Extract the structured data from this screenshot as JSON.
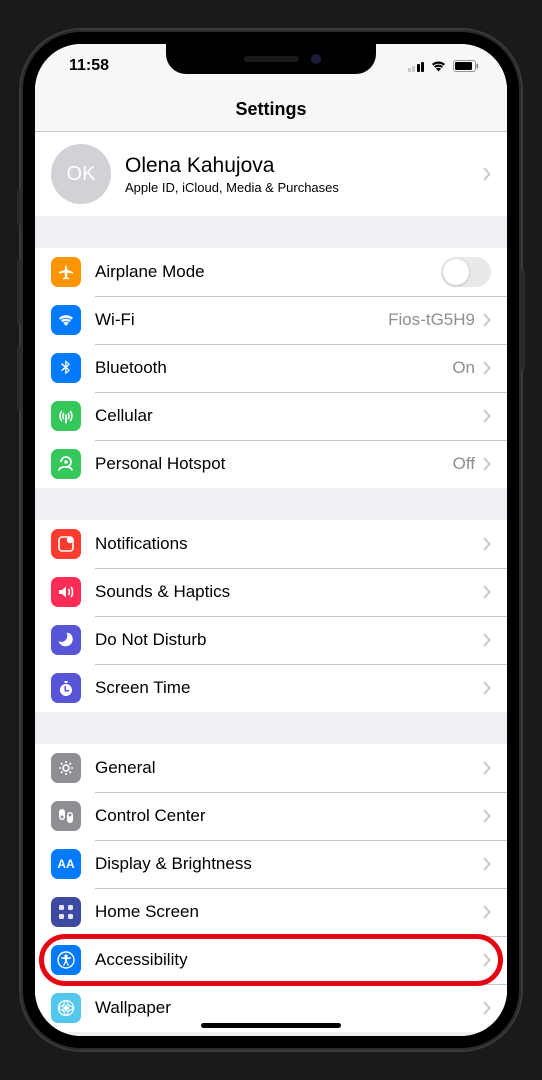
{
  "status": {
    "time": "11:58"
  },
  "title": "Settings",
  "profile": {
    "initials": "OK",
    "name": "Olena Kahujova",
    "subtitle": "Apple ID, iCloud, Media & Purchases"
  },
  "groups": [
    {
      "rows": [
        {
          "id": "airplane-mode",
          "label": "Airplane Mode",
          "iconBg": "#ff9500",
          "iconKey": "airplane",
          "control": "switch",
          "switchOn": false
        },
        {
          "id": "wifi",
          "label": "Wi-Fi",
          "iconBg": "#007aff",
          "iconKey": "wifi",
          "control": "detail",
          "detail": "Fios-tG5H9"
        },
        {
          "id": "bluetooth",
          "label": "Bluetooth",
          "iconBg": "#007aff",
          "iconKey": "bluetooth",
          "control": "detail",
          "detail": "On"
        },
        {
          "id": "cellular",
          "label": "Cellular",
          "iconBg": "#34c759",
          "iconKey": "cellular",
          "control": "disclosure"
        },
        {
          "id": "personal-hotspot",
          "label": "Personal Hotspot",
          "iconBg": "#34c759",
          "iconKey": "hotspot",
          "control": "detail",
          "detail": "Off"
        }
      ]
    },
    {
      "rows": [
        {
          "id": "notifications",
          "label": "Notifications",
          "iconBg": "#ff3b30",
          "iconKey": "notifications",
          "control": "disclosure"
        },
        {
          "id": "sounds-haptics",
          "label": "Sounds & Haptics",
          "iconBg": "#ff2d55",
          "iconKey": "sounds",
          "control": "disclosure"
        },
        {
          "id": "do-not-disturb",
          "label": "Do Not Disturb",
          "iconBg": "#5856d6",
          "iconKey": "dnd",
          "control": "disclosure"
        },
        {
          "id": "screen-time",
          "label": "Screen Time",
          "iconBg": "#5856d6",
          "iconKey": "screentime",
          "control": "disclosure"
        }
      ]
    },
    {
      "rows": [
        {
          "id": "general",
          "label": "General",
          "iconBg": "#8e8e93",
          "iconKey": "general",
          "control": "disclosure"
        },
        {
          "id": "control-center",
          "label": "Control Center",
          "iconBg": "#8e8e93",
          "iconKey": "controlcenter",
          "control": "disclosure"
        },
        {
          "id": "display-brightness",
          "label": "Display & Brightness",
          "iconBg": "#007aff",
          "iconKey": "display",
          "control": "disclosure"
        },
        {
          "id": "home-screen",
          "label": "Home Screen",
          "iconBg": "#3d4aa3",
          "iconKey": "homescreen",
          "control": "disclosure"
        },
        {
          "id": "accessibility",
          "label": "Accessibility",
          "iconBg": "#007aff",
          "iconKey": "accessibility",
          "control": "disclosure",
          "highlighted": true
        },
        {
          "id": "wallpaper",
          "label": "Wallpaper",
          "iconBg": "#54c7ec",
          "iconKey": "wallpaper",
          "control": "disclosure"
        }
      ]
    }
  ]
}
